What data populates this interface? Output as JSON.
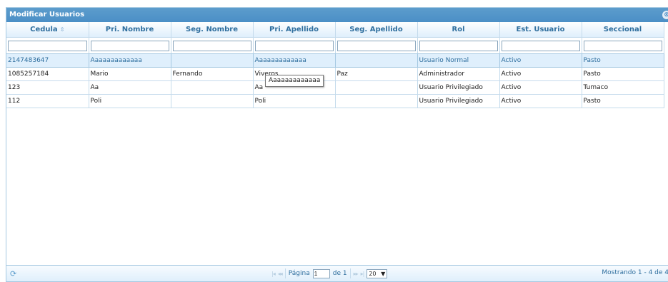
{
  "panel": {
    "title": "Modificar Usuarios"
  },
  "columns": [
    {
      "label": "Cedula",
      "sortable": true
    },
    {
      "label": "Pri. Nombre"
    },
    {
      "label": "Seg. Nombre"
    },
    {
      "label": "Pri. Apellido"
    },
    {
      "label": "Seg. Apellido"
    },
    {
      "label": "Rol"
    },
    {
      "label": "Est. Usuario"
    },
    {
      "label": "Seccional"
    }
  ],
  "rows": [
    [
      "2147483647",
      "Aaaaaaaaaaaaa",
      "",
      "Aaaaaaaaaaaaa",
      "",
      "Usuario Normal",
      "Activo",
      "Pasto"
    ],
    [
      "1085257184",
      "Mario",
      "Fernando",
      "Viveros",
      "Paz",
      "Administrador",
      "Activo",
      "Pasto"
    ],
    [
      "123",
      "Aa",
      "",
      "Aa",
      "",
      "Usuario Privilegiado",
      "Activo",
      "Tumaco"
    ],
    [
      "112",
      "Poli",
      "",
      "Poli",
      "",
      "Usuario Privilegiado",
      "Activo",
      "Pasto"
    ]
  ],
  "tooltip": "Aaaaaaaaaaaaa",
  "pager": {
    "page_label": "Página",
    "page_value": "1",
    "of_label": "de 1",
    "rows_per_page": "20",
    "records_text": "Mostrando 1 - 4 de 4"
  },
  "icons": {
    "sort": "sort-icon",
    "refresh": "refresh-icon",
    "first": "first-page-icon",
    "prev": "prev-page-icon",
    "next": "next-page-icon",
    "last": "last-page-icon",
    "close": "close-icon"
  },
  "colors": {
    "header_bar": "#5c9ccc",
    "selected_row": "#dfeffc",
    "accent_text": "#2e6e9e"
  }
}
